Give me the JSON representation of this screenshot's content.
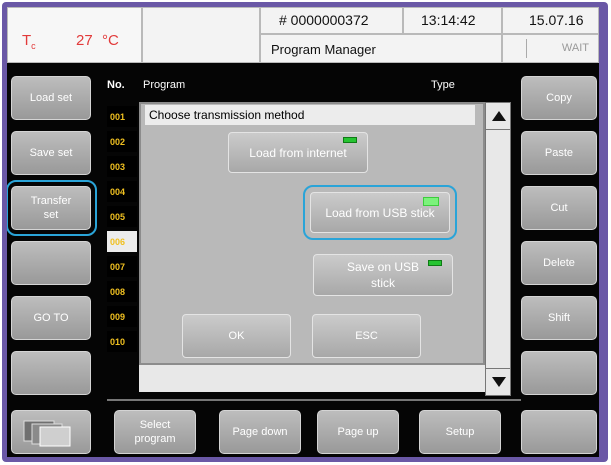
{
  "header": {
    "temp_label": "T",
    "temp_sub": "c",
    "temp_value": "27",
    "temp_unit": "°C",
    "program_number": "# 0000000372",
    "time": "13:14:42",
    "date": "15.07.16",
    "title": "Program Manager",
    "status": "WAIT"
  },
  "left_buttons": [
    "Load set",
    "Save set",
    "Transfer set",
    "",
    "GO TO",
    ""
  ],
  "right_buttons": [
    "Copy",
    "Paste",
    "Cut",
    "Delete",
    "Shift",
    ""
  ],
  "list": {
    "col_no": "No.",
    "col_program": "Program",
    "col_type": "Type",
    "numbers": [
      "001",
      "002",
      "003",
      "004",
      "005",
      "006",
      "007",
      "008",
      "009",
      "010"
    ],
    "selected": "006"
  },
  "dialog": {
    "title": "Choose transmission method",
    "load_internet": "Load from internet",
    "load_usb": "Load from USB  stick",
    "save_usb_line1": "Save on USB",
    "save_usb_line2": "stick",
    "ok": "OK",
    "esc": "ESC"
  },
  "bottom_buttons": {
    "select_line1": "Select",
    "select_line2": "program",
    "page_down": "Page down",
    "page_up": "Page up",
    "setup": "Setup"
  },
  "colors": {
    "frame": "#6a58a6",
    "highlight": "#2aa4d8",
    "number_text": "#f0c020",
    "temp_text": "#e23a3a"
  }
}
